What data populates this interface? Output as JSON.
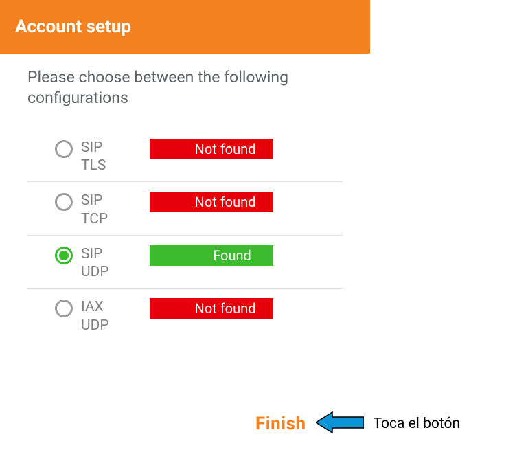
{
  "header": {
    "title": "Account setup"
  },
  "instruction": "Please choose between the following configurations",
  "options": [
    {
      "label1": "SIP",
      "label2": "TLS",
      "status": "Not found",
      "found": false,
      "selected": false
    },
    {
      "label1": "SIP",
      "label2": "TCP",
      "status": "Not found",
      "found": false,
      "selected": false
    },
    {
      "label1": "SIP",
      "label2": "UDP",
      "status": "Found",
      "found": true,
      "selected": true
    },
    {
      "label1": "IAX",
      "label2": "UDP",
      "status": "Not found",
      "found": false,
      "selected": false
    }
  ],
  "finish": {
    "label": "Finish"
  },
  "annotation": {
    "text": "Toca el botón"
  }
}
